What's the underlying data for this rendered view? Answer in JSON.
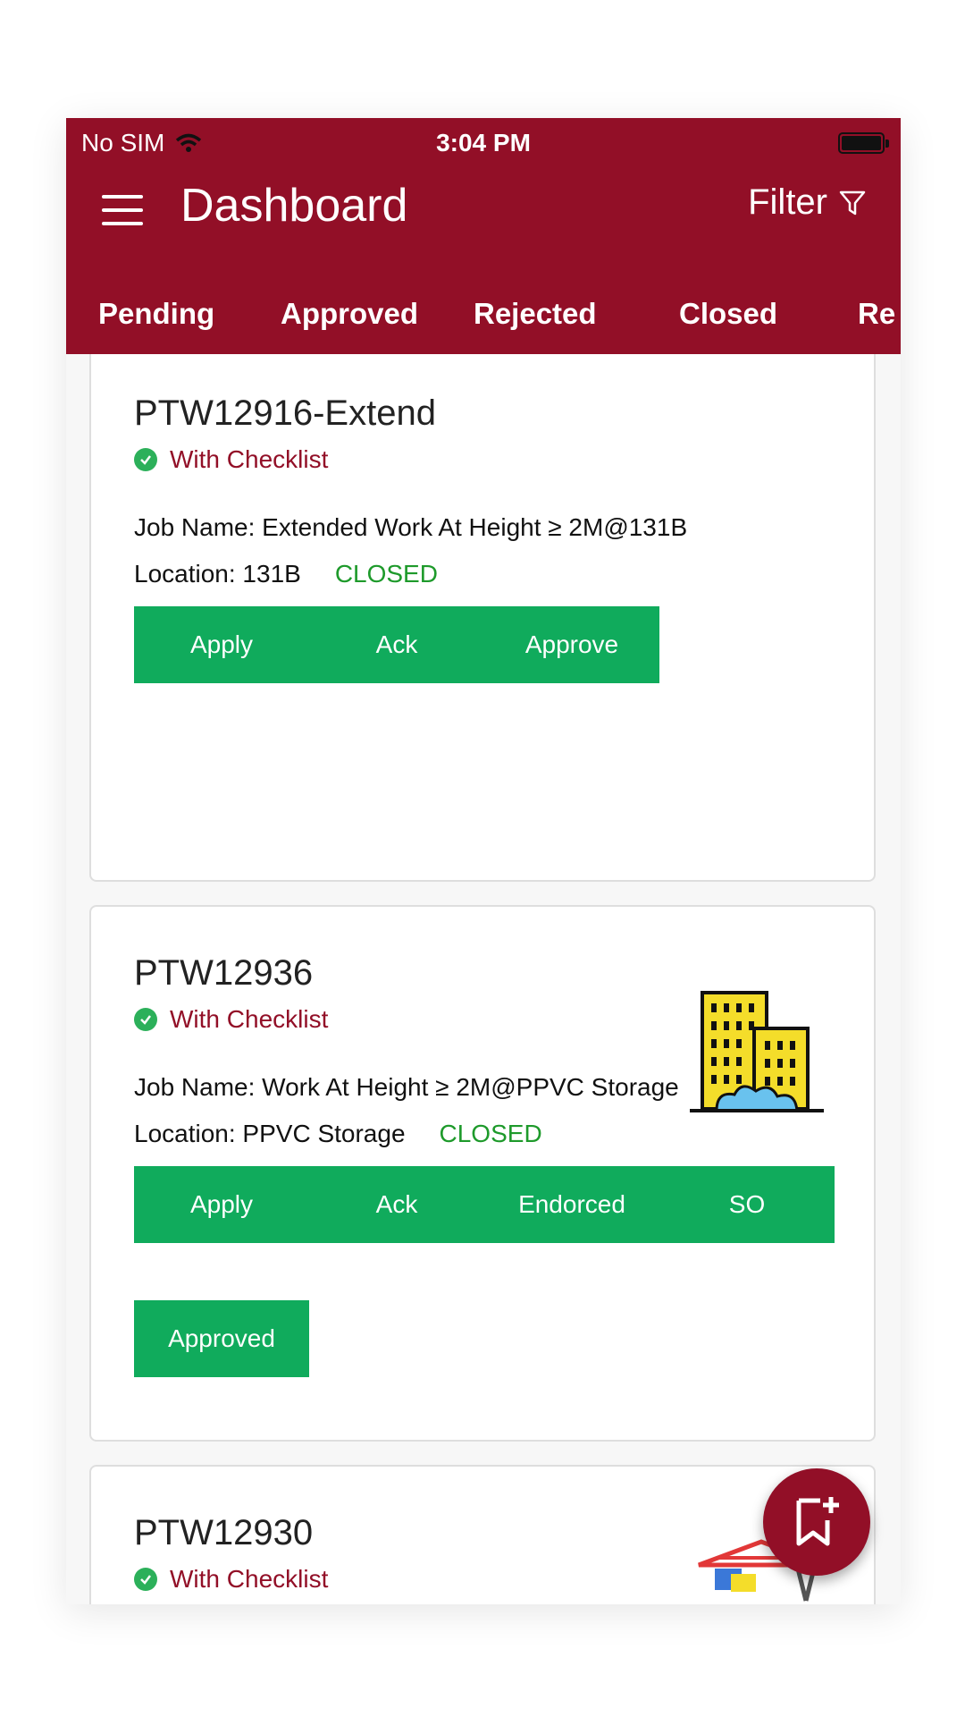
{
  "status_bar": {
    "carrier": "No SIM",
    "time": "3:04 PM"
  },
  "header": {
    "title": "Dashboard",
    "filter_label": "Filter"
  },
  "tabs": [
    {
      "label": "Pending"
    },
    {
      "label": "Approved"
    },
    {
      "label": "Rejected"
    },
    {
      "label": "Closed"
    },
    {
      "label": "Re"
    }
  ],
  "cards": [
    {
      "id": "PTW12916-Extend",
      "checklist": "With Checklist",
      "job": "Job Name: Extended Work At Height ≥ 2M@131B",
      "location": "Location: 131B",
      "status": "CLOSED",
      "steps": [
        "Apply",
        "Ack",
        "Approve"
      ]
    },
    {
      "id": "PTW12936",
      "checklist": "With Checklist",
      "job": "Job Name: Work At Height ≥ 2M@PPVC Storage",
      "location": "Location: PPVC Storage",
      "status": "CLOSED",
      "steps": [
        "Apply",
        "Ack",
        "Endorced",
        "SO"
      ],
      "extra_step": "Approved",
      "illustration": "buildings-icon"
    },
    {
      "id": "PTW12930",
      "checklist": "With Checklist",
      "illustration": "crane-icon"
    }
  ],
  "fab": {
    "icon": "bookmark-add-icon"
  },
  "colors": {
    "header": "#920f27",
    "button_green": "#10ab5c",
    "status_green": "#1e9a2b"
  }
}
